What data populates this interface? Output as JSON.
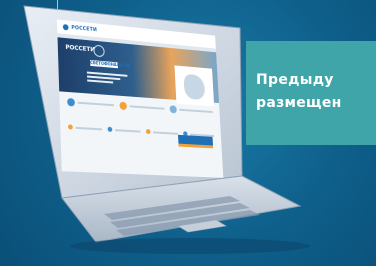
{
  "banner": {
    "line1": "Предыду",
    "line2": "размещен"
  },
  "site": {
    "logo_text": "РОССЕТИ",
    "hero_brand": "РОССЕТИ",
    "hero_tag": "СВЕТОФОНАЛЬ.РФ"
  },
  "colors": {
    "background": "#0e5f8a",
    "banner": "#3fa5a8",
    "brand_blue": "#1e6fb5",
    "accent_orange": "#f2a23a"
  }
}
